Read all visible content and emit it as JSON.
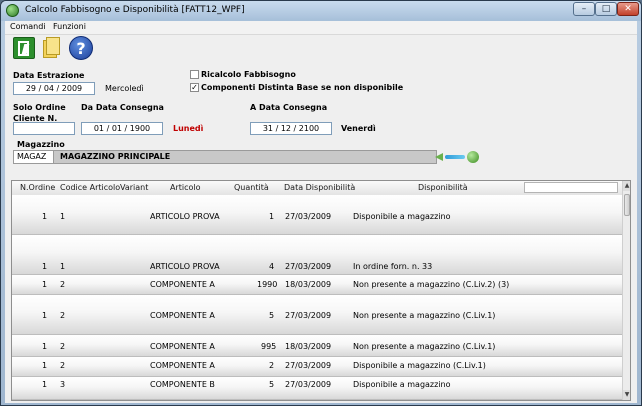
{
  "window": {
    "title": "Calcolo Fabbisogno e Disponibilità [FATT12_WPF]"
  },
  "menu": {
    "items": [
      "Comandi",
      "Funzioni"
    ]
  },
  "filters": {
    "data_estrazione_label": "Data Estrazione",
    "data_estrazione": {
      "day": "29",
      "month": "04",
      "year": "2009"
    },
    "data_estrazione_weekday": "Mercoledì",
    "ricalcolo_label": "Ricalcolo Fabbisogno",
    "ricalcolo_checked": false,
    "componenti_label": "Componenti Distinta Base se non disponibile",
    "componenti_checked": true,
    "solo_ordine_label": "Solo Ordine",
    "cliente_label": "Cliente N.",
    "cliente_value": "",
    "da_data_label": "Da Data Consegna",
    "da_data": {
      "day": "01",
      "month": "01",
      "year": "1900"
    },
    "da_data_weekday": "Lunedì",
    "a_data_label": "A Data Consegna",
    "a_data": {
      "day": "31",
      "month": "12",
      "year": "2100"
    },
    "a_data_weekday": "Venerdì",
    "magazzino_label": "Magazzino",
    "magazzino_code": "MAGAZ",
    "magazzino_name": "MAGAZZINO PRINCIPALE"
  },
  "grid": {
    "columns": [
      "N.Ordine",
      "Codice Articolo",
      "Variant",
      "Articolo",
      "Quantità",
      "Data Disponibilità",
      "Disponibilità"
    ],
    "rows": [
      {
        "ordine": "1",
        "codice": "1",
        "variant": "",
        "articolo": "ARTICOLO PROVA",
        "quantita": "1",
        "data": "27/03/2009",
        "disponibilita": "Disponibile a magazzino"
      },
      {
        "ordine": "1",
        "codice": "1",
        "variant": "",
        "articolo": "ARTICOLO PROVA",
        "quantita": "4",
        "data": "27/03/2009",
        "disponibilita": "In ordine forn. n. 33"
      },
      {
        "ordine": "1",
        "codice": "2",
        "variant": "",
        "articolo": "COMPONENTE A",
        "quantita": "1990",
        "data": "18/03/2009",
        "disponibilita": "Non presente a magazzino (C.Liv.2) (3)"
      },
      {
        "ordine": "1",
        "codice": "2",
        "variant": "",
        "articolo": "COMPONENTE A",
        "quantita": "5",
        "data": "27/03/2009",
        "disponibilita": "Non presente a magazzino (C.Liv.1)"
      },
      {
        "ordine": "1",
        "codice": "2",
        "variant": "",
        "articolo": "COMPONENTE A",
        "quantita": "995",
        "data": "18/03/2009",
        "disponibilita": "Non presente a magazzino (C.Liv.1)"
      },
      {
        "ordine": "1",
        "codice": "2",
        "variant": "",
        "articolo": "COMPONENTE A",
        "quantita": "2",
        "data": "27/03/2009",
        "disponibilita": "Disponibile a magazzino (C.Liv.1)"
      },
      {
        "ordine": "1",
        "codice": "3",
        "variant": "",
        "articolo": "COMPONENTE B",
        "quantita": "5",
        "data": "27/03/2009",
        "disponibilita": "Disponibile a magazzino"
      }
    ]
  }
}
